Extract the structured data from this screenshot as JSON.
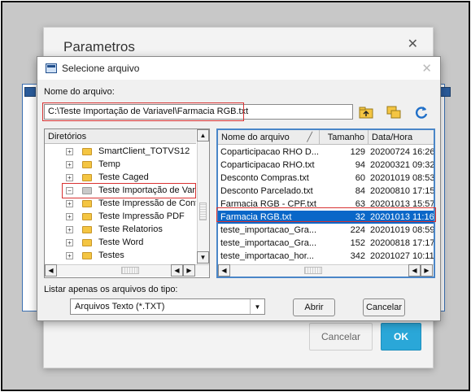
{
  "background_dialog": {
    "title": "Parametros",
    "close": "✕",
    "cancel_label": "Cancelar",
    "ok_label": "OK"
  },
  "dialog": {
    "title": "Selecione arquivo",
    "close": "✕",
    "filename_label": "Nome do arquivo:",
    "filename_value": "C:\\Teste Importação de Variavel\\Farmacia RGB.txt",
    "toolbar_icons": [
      "folder-up-icon",
      "copy-folders-icon",
      "refresh-icon"
    ],
    "directories": {
      "header": "Diretórios",
      "items": [
        {
          "label": "SmartClient_TOTVS12",
          "expander": "+"
        },
        {
          "label": "Temp",
          "expander": "+"
        },
        {
          "label": "Teste Caged",
          "expander": "+"
        },
        {
          "label": "Teste Importação de Vari",
          "expander": "−"
        },
        {
          "label": "Teste Impressão de Contr",
          "expander": "+"
        },
        {
          "label": "Teste Impressão PDF",
          "expander": "+"
        },
        {
          "label": "Teste Relatorios",
          "expander": "+"
        },
        {
          "label": "Teste Word",
          "expander": "+"
        },
        {
          "label": "Testes",
          "expander": "+"
        }
      ]
    },
    "files": {
      "columns": [
        "Nome do arquivo",
        "Tamanho",
        "Data/Hora"
      ],
      "rows": [
        {
          "name": "Coparticipacao RHO D...",
          "size": "129",
          "date": "20200724 16:26"
        },
        {
          "name": "Coparticipacao RHO.txt",
          "size": "94",
          "date": "20200321 09:32"
        },
        {
          "name": "Desconto Compras.txt",
          "size": "60",
          "date": "20201019 08:53"
        },
        {
          "name": "Desconto Parcelado.txt",
          "size": "84",
          "date": "20200810 17:15"
        },
        {
          "name": "Farmacia RGB - CPF.txt",
          "size": "63",
          "date": "20201013 15:57"
        },
        {
          "name": "Farmacia RGB.txt",
          "size": "32",
          "date": "20201013 11:16"
        },
        {
          "name": "teste_importacao_Gra...",
          "size": "224",
          "date": "20201019 08:59"
        },
        {
          "name": "teste_importacao_Gra...",
          "size": "152",
          "date": "20200818 17:17"
        },
        {
          "name": "teste_importacao_hor...",
          "size": "342",
          "date": "20201027 10:11"
        }
      ]
    },
    "type_label": "Listar apenas os arquivos do tipo:",
    "type_value": "Arquivos Texto (*.TXT)",
    "open_label": "Abrir",
    "cancel_label": "Cancelar"
  }
}
